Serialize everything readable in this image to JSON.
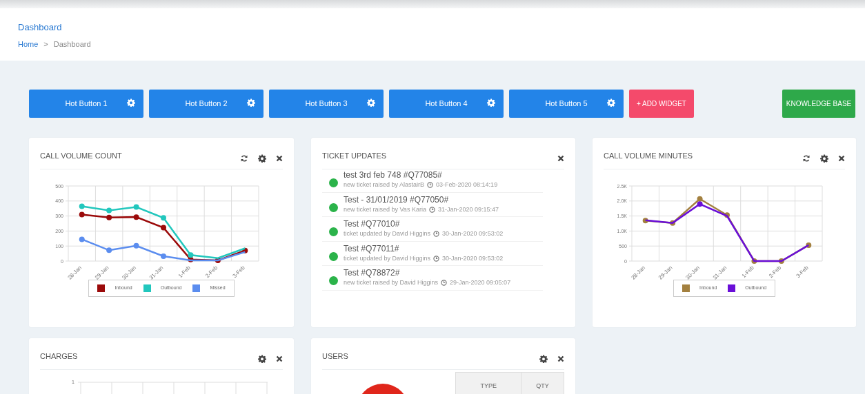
{
  "header": {
    "title": "Dashboard",
    "breadcrumb": [
      {
        "label": "Home",
        "selected": false
      },
      {
        "label": "Dashboard",
        "selected": true
      }
    ],
    "separator": ">"
  },
  "toolbar": {
    "hot_buttons": [
      "Hot Button 1",
      "Hot Button 2",
      "Hot Button 3",
      "Hot Button 4",
      "Hot Button 5"
    ],
    "add_widget": "+ ADD WIDGET",
    "knowledge_base": "KNOWLEDGE BASE"
  },
  "widgets": [
    {
      "kind": "chart",
      "title": "CALL VOLUME COUNT",
      "refresh": true,
      "chart_data": {
        "type": "line",
        "grid": true,
        "categories": [
          "28-Jan",
          "29-Jan",
          "30-Jan",
          "31-Jan",
          "1-Feb",
          "2-Feb",
          "3-Feb"
        ],
        "ylim": [
          0,
          500
        ],
        "yticks": [
          0,
          100,
          200,
          300,
          400,
          500
        ],
        "series": [
          {
            "name": "Inbound",
            "color": "#9b0a0a",
            "marker": true,
            "values": [
              310,
              290,
              293,
              222,
              10,
              5,
              70
            ]
          },
          {
            "name": "Outbound",
            "color": "#22c7bd",
            "marker": true,
            "values": [
              365,
              337,
              360,
              288,
              40,
              20,
              85
            ]
          },
          {
            "name": "Missed",
            "color": "#5b8def",
            "marker": true,
            "values": [
              145,
              72,
              102,
              32,
              5,
              5,
              60
            ]
          }
        ]
      }
    },
    {
      "kind": "tickets",
      "title": "TICKET UPDATES",
      "refresh": false,
      "items": [
        {
          "title": "test 3rd feb 748 #Q77085#",
          "text": "new ticket raised by AlastairB",
          "time": "03-Feb-2020 08:14:19",
          "color": "#2bb34a"
        },
        {
          "title": "Test - 31/01/2019 #Q77050#",
          "text": "new ticket raised by Vas Karia",
          "time": "31-Jan-2020 09:15:47",
          "color": "#2bb34a"
        },
        {
          "title": "Test #Q77010#",
          "text": "ticket updated by David Higgins",
          "time": "30-Jan-2020 09:53:02",
          "color": "#2bb34a"
        },
        {
          "title": "Test #Q77011#",
          "text": "ticket updated by David Higgins",
          "time": "30-Jan-2020 09:53:02",
          "color": "#2bb34a"
        },
        {
          "title": "Test #Q78872#",
          "text": "new ticket raised by David Higgins",
          "time": "29-Jan-2020 09:05:07",
          "color": "#2bb34a"
        }
      ]
    },
    {
      "kind": "chart",
      "title": "CALL VOLUME MINUTES",
      "refresh": true,
      "chart_data": {
        "type": "line",
        "grid": true,
        "categories": [
          "28-Jan",
          "29-Jan",
          "30-Jan",
          "31-Jan",
          "1-Feb",
          "2-Feb",
          "3-Feb"
        ],
        "ylim": [
          0,
          2500
        ],
        "yticks": [
          0,
          {
            "value": 500,
            "label": "500"
          },
          {
            "value": 1000,
            "label": "1.0K"
          },
          {
            "value": 1500,
            "label": "1.5K"
          },
          {
            "value": 2000,
            "label": "2.0K"
          },
          {
            "value": 2500,
            "label": "2.5K"
          }
        ],
        "series": [
          {
            "name": "Inbound",
            "color": "#a3803f",
            "marker": true,
            "values": [
              1350,
              1270,
              2070,
              1530,
              0,
              0,
              530
            ]
          },
          {
            "name": "Outbound",
            "color": "#6a0fd8",
            "marker": true,
            "values": [
              1360,
              1270,
              1900,
              1500,
              0,
              0,
              530
            ]
          }
        ]
      }
    },
    {
      "kind": "charges",
      "title": "CHARGES",
      "refresh": false,
      "y_tick_label": "1"
    },
    {
      "kind": "users",
      "title": "USERS",
      "refresh": false,
      "columns": [
        "TYPE",
        "QTY"
      ]
    }
  ]
}
